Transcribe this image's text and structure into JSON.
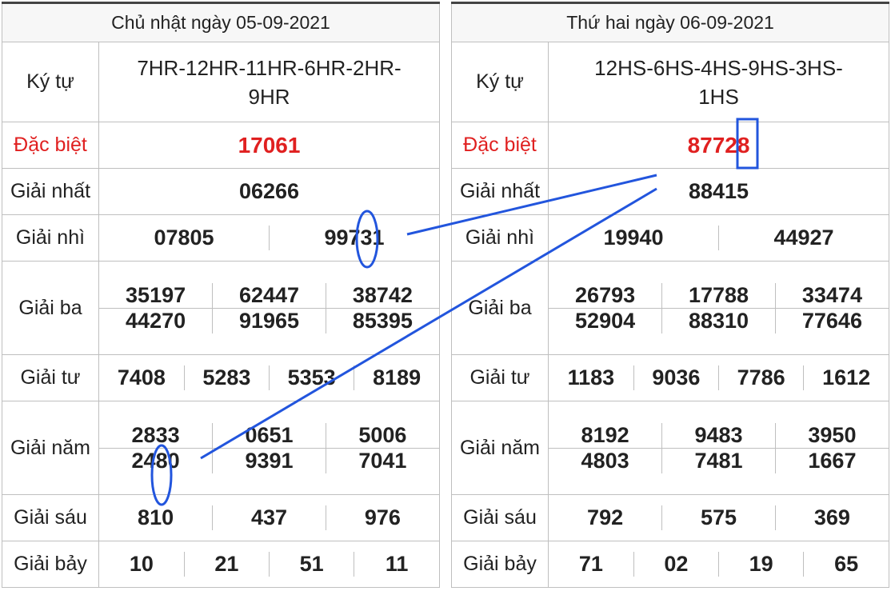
{
  "left": {
    "date": "Chủ nhật ngày 05-09-2021",
    "labels": {
      "kytu": "Ký tự",
      "db": "Đặc biệt",
      "g1": "Giải nhất",
      "g2": "Giải nhì",
      "g3": "Giải ba",
      "g4": "Giải tư",
      "g5": "Giải năm",
      "g6": "Giải sáu",
      "g7": "Giải bảy"
    },
    "kytu_line1": "7HR-12HR-11HR-6HR-2HR-",
    "kytu_line2": "9HR",
    "db": "17061",
    "g1": "06266",
    "g2": [
      "07805",
      "99731"
    ],
    "g3": [
      "35197",
      "62447",
      "38742",
      "44270",
      "91965",
      "85395"
    ],
    "g4": [
      "7408",
      "5283",
      "5353",
      "8189"
    ],
    "g5": [
      "2833",
      "0651",
      "5006",
      "2480",
      "9391",
      "7041"
    ],
    "g6": [
      "810",
      "437",
      "976"
    ],
    "g7": [
      "10",
      "21",
      "51",
      "11"
    ]
  },
  "right": {
    "date": "Thứ hai ngày 06-09-2021",
    "labels": {
      "kytu": "Ký tự",
      "db": "Đặc biệt",
      "g1": "Giải nhất",
      "g2": "Giải nhì",
      "g3": "Giải ba",
      "g4": "Giải tư",
      "g5": "Giải năm",
      "g6": "Giải sáu",
      "g7": "Giải bảy"
    },
    "kytu_line1": "12HS-6HS-4HS-9HS-3HS-",
    "kytu_line2": "1HS",
    "db": "87728",
    "g1": "88415",
    "g2": [
      "19940",
      "44927"
    ],
    "g3": [
      "26793",
      "17788",
      "33474",
      "52904",
      "88310",
      "77646"
    ],
    "g4": [
      "1183",
      "9036",
      "7786",
      "1612"
    ],
    "g5": [
      "8192",
      "9483",
      "3950",
      "4803",
      "7481",
      "1667"
    ],
    "g6": [
      "792",
      "575",
      "369"
    ],
    "g7": [
      "71",
      "02",
      "19",
      "65"
    ]
  },
  "colors": {
    "accent_red": "#e02020",
    "annotation_blue": "#2255dd",
    "border": "#bfbfbf"
  }
}
